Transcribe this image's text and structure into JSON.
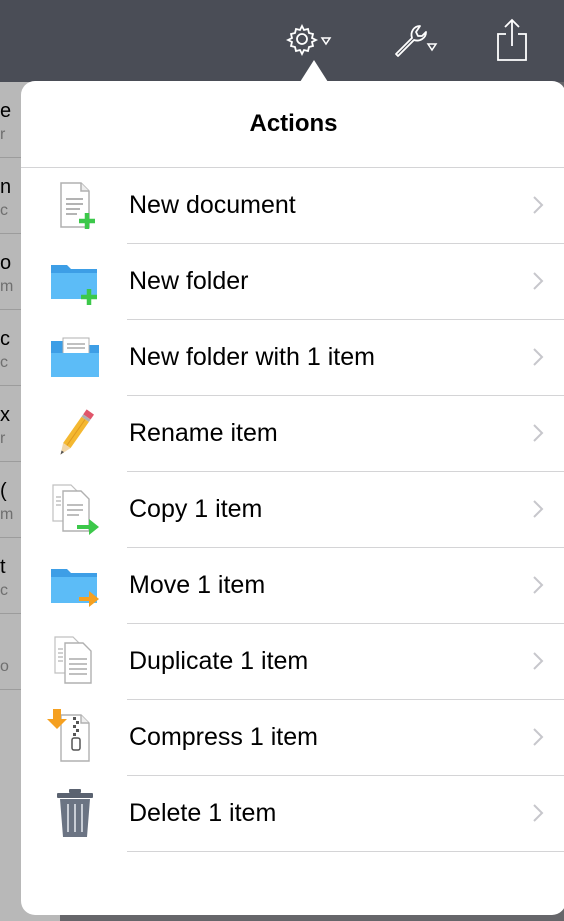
{
  "toolbar": {
    "icons": [
      "gear-icon",
      "wrench-icon",
      "share-icon"
    ]
  },
  "background_list": [
    {
      "a": "e",
      "b": "r"
    },
    {
      "a": "n",
      "b": "c"
    },
    {
      "a": "o",
      "b": "m"
    },
    {
      "a": "c",
      "b": "c"
    },
    {
      "a": "x",
      "b": "r"
    },
    {
      "a": "(",
      "b": "m"
    },
    {
      "a": "t",
      "b": "c"
    },
    {
      "a": "",
      "b": "o"
    }
  ],
  "popover": {
    "title": "Actions",
    "items": [
      {
        "label": "New document",
        "icon": "new-document-icon"
      },
      {
        "label": "New folder",
        "icon": "new-folder-icon"
      },
      {
        "label": "New folder with 1 item",
        "icon": "folder-with-item-icon"
      },
      {
        "label": "Rename item",
        "icon": "pencil-icon"
      },
      {
        "label": "Copy 1 item",
        "icon": "copy-icon"
      },
      {
        "label": "Move 1 item",
        "icon": "move-folder-icon"
      },
      {
        "label": "Duplicate 1 item",
        "icon": "duplicate-icon"
      },
      {
        "label": "Compress 1 item",
        "icon": "compress-icon"
      },
      {
        "label": "Delete 1 item",
        "icon": "trash-icon"
      }
    ]
  },
  "colors": {
    "toolbar": "#4a4d56",
    "folder_blue": "#4aaef0",
    "plus_green": "#3cc84a",
    "arrow_orange": "#f5a020",
    "chevron": "#c7c7cc"
  }
}
